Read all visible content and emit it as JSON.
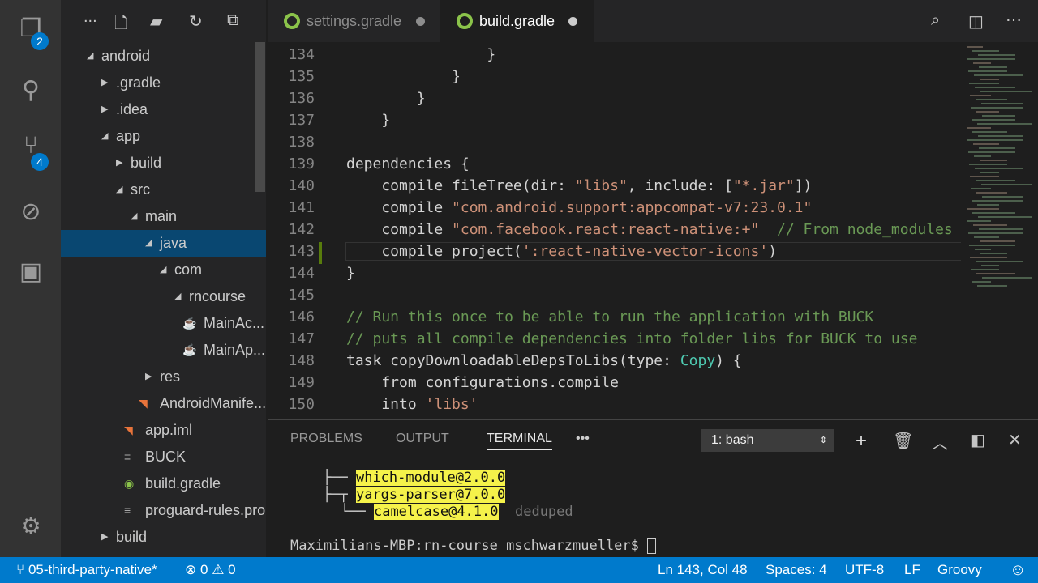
{
  "activity": {
    "explorer_badge": "2",
    "scm_badge": "4"
  },
  "sidebar": {
    "more": "...",
    "items": [
      {
        "label": "android",
        "depth": 0,
        "arrow": "open"
      },
      {
        "label": ".gradle",
        "depth": 1,
        "arrow": "closed"
      },
      {
        "label": ".idea",
        "depth": 1,
        "arrow": "closed"
      },
      {
        "label": "app",
        "depth": 1,
        "arrow": "open"
      },
      {
        "label": "build",
        "depth": 2,
        "arrow": "closed"
      },
      {
        "label": "src",
        "depth": 2,
        "arrow": "open"
      },
      {
        "label": "main",
        "depth": 3,
        "arrow": "open"
      },
      {
        "label": "java",
        "depth": 4,
        "arrow": "open",
        "selected": true
      },
      {
        "label": "com",
        "depth": 5,
        "arrow": "open"
      },
      {
        "label": "rncourse",
        "depth": 6,
        "arrow": "open"
      },
      {
        "label": "MainAc...",
        "depth": 7,
        "icon": "java"
      },
      {
        "label": "MainAp...",
        "depth": 7,
        "icon": "java"
      },
      {
        "label": "res",
        "depth": 4,
        "arrow": "closed"
      },
      {
        "label": "AndroidManife...",
        "depth": 4,
        "icon": "rss"
      },
      {
        "label": "app.iml",
        "depth": 3,
        "icon": "rss"
      },
      {
        "label": "BUCK",
        "depth": 3,
        "icon": "file"
      },
      {
        "label": "build.gradle",
        "depth": 3,
        "icon": "gradle"
      },
      {
        "label": "proguard-rules.pro",
        "depth": 3,
        "icon": "file"
      },
      {
        "label": "build",
        "depth": 1,
        "arrow": "closed"
      }
    ]
  },
  "tabs": [
    {
      "label": "settings.gradle",
      "active": false
    },
    {
      "label": "build.gradle",
      "active": true
    }
  ],
  "code": [
    {
      "n": "134",
      "parts": [
        [
          "",
          "                }"
        ]
      ]
    },
    {
      "n": "135",
      "parts": [
        [
          "",
          "            }"
        ]
      ]
    },
    {
      "n": "136",
      "parts": [
        [
          "",
          "        }"
        ]
      ]
    },
    {
      "n": "137",
      "parts": [
        [
          "",
          "    }"
        ]
      ]
    },
    {
      "n": "138",
      "parts": []
    },
    {
      "n": "139",
      "parts": [
        [
          "",
          "dependencies {"
        ]
      ]
    },
    {
      "n": "140",
      "parts": [
        [
          "",
          "    compile fileTree(dir: "
        ],
        [
          "s",
          "\"libs\""
        ],
        [
          "",
          ", include: ["
        ],
        [
          "s",
          "\"*.jar\""
        ],
        [
          "",
          "])"
        ]
      ]
    },
    {
      "n": "141",
      "parts": [
        [
          "",
          "    compile "
        ],
        [
          "s",
          "\"com.android.support:appcompat-v7:23.0.1\""
        ]
      ]
    },
    {
      "n": "142",
      "parts": [
        [
          "",
          "    compile "
        ],
        [
          "s",
          "\"com.facebook.react:react-native:+\""
        ],
        [
          "",
          "  "
        ],
        [
          "c",
          "// From node_modules"
        ]
      ]
    },
    {
      "n": "143",
      "parts": [
        [
          "",
          "    compile project("
        ],
        [
          "s",
          "':react-native-vector-icons'"
        ],
        [
          "",
          ")"
        ]
      ]
    },
    {
      "n": "144",
      "parts": [
        [
          "",
          "}"
        ]
      ]
    },
    {
      "n": "145",
      "parts": []
    },
    {
      "n": "146",
      "parts": [
        [
          "c",
          "// Run this once to be able to run the application with BUCK"
        ]
      ]
    },
    {
      "n": "147",
      "parts": [
        [
          "c",
          "// puts all compile dependencies into folder libs for BUCK to use"
        ]
      ]
    },
    {
      "n": "148",
      "parts": [
        [
          "",
          "task copyDownloadableDepsToLibs(type: "
        ],
        [
          "t",
          "Copy"
        ],
        [
          "",
          ") {"
        ]
      ]
    },
    {
      "n": "149",
      "parts": [
        [
          "",
          "    from configurations.compile"
        ]
      ]
    },
    {
      "n": "150",
      "parts": [
        [
          "",
          "    into "
        ],
        [
          "s",
          "'libs'"
        ]
      ]
    }
  ],
  "panel": {
    "tabs": [
      "PROBLEMS",
      "OUTPUT",
      "TERMINAL"
    ],
    "more": "•••",
    "shell_select": "1: bash",
    "terminal": {
      "l1_tree": "├──",
      "l1": "which-module@2.0.0",
      "l2_tree": "├─┬",
      "l2": "yargs-parser@7.0.0",
      "l3_tree": "└──",
      "l3": "camelcase@4.1.0",
      "l3_suffix": "deduped",
      "prompt": "Maximilians-MBP:rn-course mschwarzmueller$ "
    }
  },
  "status": {
    "branch": "05-third-party-native*",
    "errors": "0",
    "warnings": "0",
    "position": "Ln 143, Col 48",
    "spaces": "Spaces: 4",
    "encoding": "UTF-8",
    "eol": "LF",
    "language": "Groovy"
  },
  "colors": {
    "status_bar": "#007acc",
    "selection": "#094771",
    "gradle_icon": "#8bc34a"
  }
}
